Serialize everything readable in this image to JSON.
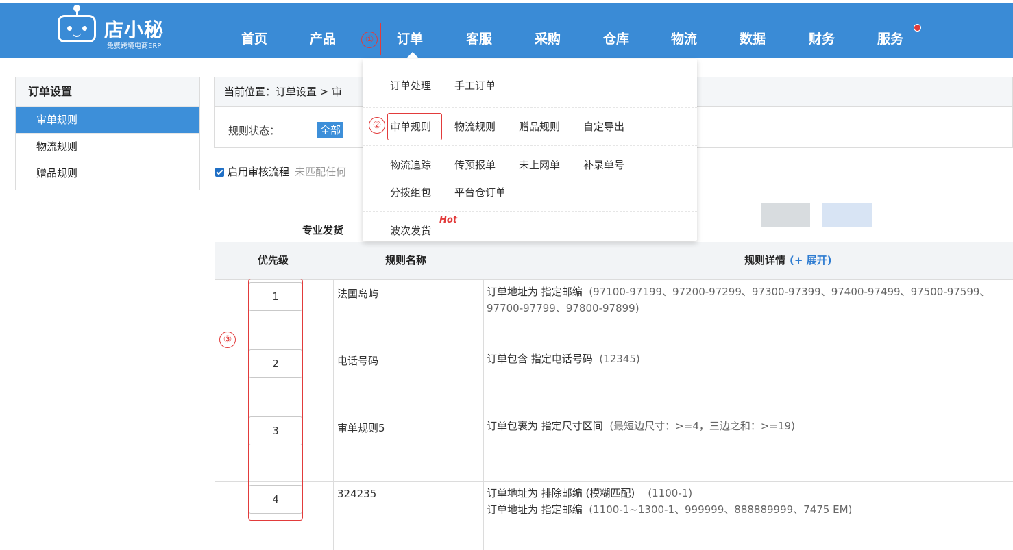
{
  "app": {
    "logo_name": "店小秘",
    "logo_tagline": "免费跨境电商ERP"
  },
  "nav": {
    "items": [
      "首页",
      "产品",
      "订单",
      "客服",
      "采购",
      "仓库",
      "物流",
      "数据",
      "财务",
      "服务"
    ],
    "active": "订单"
  },
  "markers": [
    "①",
    "②",
    "③"
  ],
  "sidebar": {
    "title": "订单设置",
    "items": [
      "审单规则",
      "物流规则",
      "赠品规则"
    ],
    "active": "审单规则"
  },
  "breadcrumb": "当前位置：订单设置 > 审",
  "filter": {
    "label": "规则状态：",
    "value": "全部"
  },
  "checkbox": {
    "label": "启用审核流程",
    "hint": "未匹配任何"
  },
  "dropdown": {
    "row1": [
      "订单处理",
      "手工订单"
    ],
    "row2": [
      "审单规则",
      "物流规则",
      "赠品规则",
      "自定导出"
    ],
    "row3": [
      "物流追踪",
      "传预报单",
      "未上网单",
      "补录单号"
    ],
    "row4": [
      "分拨组包",
      "平台仓订单"
    ],
    "section_label": "专业发货",
    "row5": [
      "波次发货"
    ],
    "hot_badge": "Hot"
  },
  "table": {
    "headers": {
      "priority": "优先级",
      "name": "规则名称",
      "detail": "规则详情",
      "expand": "(+ 展开)"
    },
    "rows": [
      {
        "priority": "1",
        "name": "法国岛屿",
        "detail_line1_label": "订单地址为 指定邮编",
        "detail_line1_value": "(97100-97199、97200-97299、97300-97399、97400-97499、97500-97599、",
        "detail_line2": "97700-97799、97800-97899)"
      },
      {
        "priority": "2",
        "name": "电话号码",
        "detail_line1_label": "订单包含 指定电话号码",
        "detail_line1_value": "(12345)",
        "detail_line2": ""
      },
      {
        "priority": "3",
        "name": "审单规则5",
        "detail_line1_label": "订单包裹为 指定尺寸区间",
        "detail_line1_value": "(最短边尺寸：>=4，三边之和：>=19)",
        "detail_line2": ""
      },
      {
        "priority": "4",
        "name": "324235",
        "detail_line1_label": "订单地址为 排除邮编 (模糊匹配)",
        "detail_line1_value": "(1100-1)",
        "detail_line2_label": "订单地址为 指定邮编",
        "detail_line2_value": "(1100-1~1300-1、999999、888889999、7475 EM)"
      }
    ]
  }
}
